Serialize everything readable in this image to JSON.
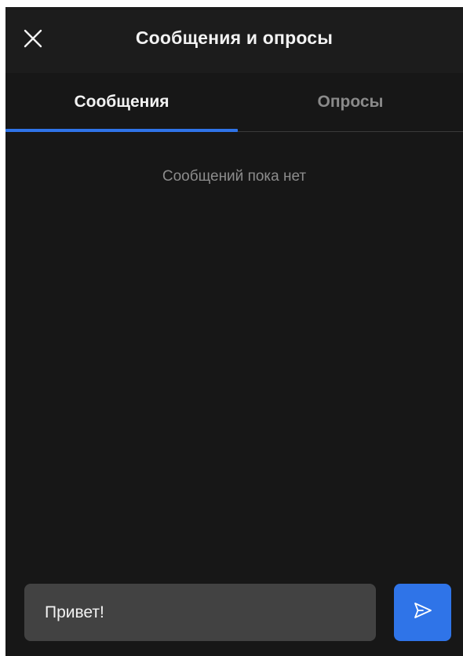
{
  "header": {
    "title": "Сообщения и опросы",
    "close_icon": "close-icon"
  },
  "tabs": [
    {
      "label": "Сообщения",
      "active": true
    },
    {
      "label": "Опросы",
      "active": false
    }
  ],
  "messages": {
    "empty_text": "Сообщений пока нет"
  },
  "composer": {
    "value": "Привет!",
    "send_icon": "send-icon"
  },
  "colors": {
    "background": "#171717",
    "header": "#1c1c1c",
    "accent": "#2f74e8",
    "input": "#424242",
    "text": "#f2f2f2",
    "muted": "#8a8a8a"
  }
}
